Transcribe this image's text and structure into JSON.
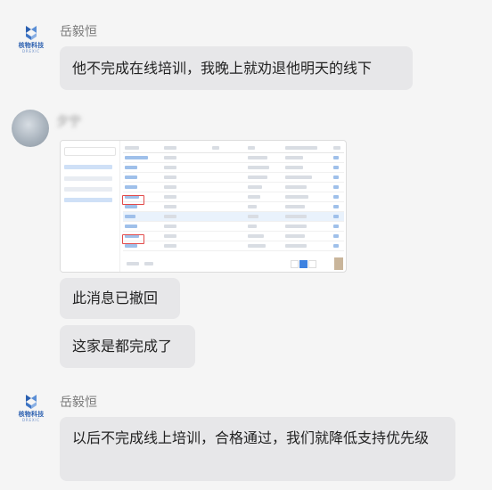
{
  "messages": [
    {
      "sender": "岳毅恒",
      "avatar_logo": "核物科技",
      "avatar_sub": "DREXIC",
      "text": "他不完成在线培训，我晚上就劝退他明天的线下"
    },
    {
      "sender": "夕宁",
      "text_recalled": "此消息已撤回",
      "text": "这家是都完成了"
    },
    {
      "sender": "岳毅恒",
      "avatar_logo": "核物科技",
      "avatar_sub": "DREXIC",
      "text": "以后不完成线上培训，合格通过，我们就降低支持优先级"
    }
  ],
  "colors": {
    "bubble": "#e7e7e9",
    "background": "#f5f5f5",
    "highlight_box": "#e24b4b",
    "accent": "#3d82e0"
  },
  "icons": [
    "company-logo-icon",
    "user-photo-avatar"
  ]
}
